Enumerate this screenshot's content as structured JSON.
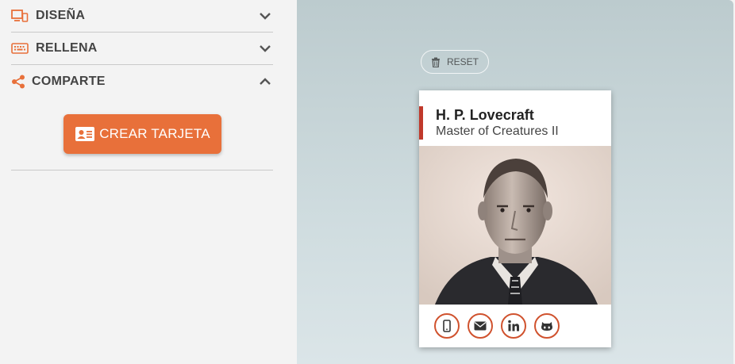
{
  "sidebar": {
    "sections": [
      {
        "label": "DISEÑA",
        "icon": "devices-icon",
        "state": "collapsed"
      },
      {
        "label": "RELLENA",
        "icon": "keyboard-icon",
        "state": "collapsed"
      },
      {
        "label": "COMPARTE",
        "icon": "share-icon",
        "state": "expanded"
      }
    ],
    "create_button": {
      "label": "CREAR TARJETA",
      "icon": "id-card-icon"
    }
  },
  "preview": {
    "reset_button": {
      "label": "RESET",
      "icon": "trash-icon"
    },
    "card": {
      "name": "H. P. Lovecraft",
      "title": "Master of Creatures II",
      "accent_color": "#c0392b",
      "photo": "portrait-photo",
      "contact_icons": [
        "phone-icon",
        "mail-icon",
        "linkedin-icon",
        "github-icon"
      ]
    }
  },
  "colors": {
    "accent": "#e8703a",
    "icon_accent": "#d0522e"
  }
}
